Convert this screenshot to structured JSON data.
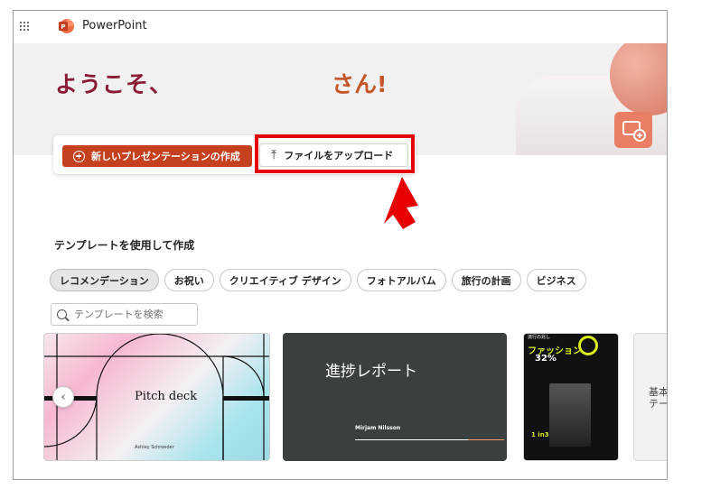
{
  "app": {
    "title": "PowerPoint"
  },
  "hero": {
    "greeting": "ようこそ、",
    "greeting_suffix": "さん!"
  },
  "actions": {
    "new_label": "新しいプレゼンテーションの作成",
    "upload_label": "ファイルをアップロード"
  },
  "templates": {
    "section_title": "テンプレートを使用して作成",
    "categories": [
      "レコメンデーション",
      "お祝い",
      "クリエイティブ デザイン",
      "フォトアルバム",
      "旅行の計画",
      "ビジネス"
    ],
    "search_placeholder": "テンプレートを検索",
    "items": [
      {
        "title": "Pitch deck",
        "author": "Ashley Schroeder"
      },
      {
        "title": "進捗レポート",
        "author": "Mirjam Nilsson"
      },
      {
        "title": "ファッション",
        "subtitle": "流行の兆し",
        "stat": "32%",
        "value": "1 in3"
      },
      {
        "title": "基本\nテー"
      }
    ]
  },
  "colors": {
    "brand": "#c4401f",
    "greeting": "#8b1c36",
    "highlight": "#e60000"
  }
}
